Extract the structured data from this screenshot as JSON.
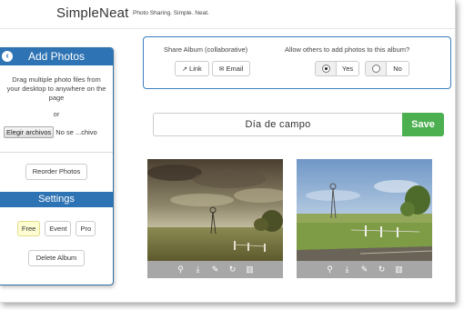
{
  "header": {
    "brand": "SimpleNeat",
    "tagline": "Photo Sharing. Simple. Neat."
  },
  "sidebar": {
    "title": "Add Photos",
    "drag_text": "Drag multiple photo files from your desktop to anywhere on the page",
    "or_text": "or",
    "file_button": "Elegir archivos",
    "file_status": "No se ...chivo",
    "reorder_label": "Reorder Photos",
    "settings_title": "Settings",
    "modes": [
      {
        "label": "Free",
        "active": true
      },
      {
        "label": "Event",
        "active": false
      },
      {
        "label": "Pro",
        "active": false
      }
    ],
    "delete_label": "Delete Album"
  },
  "share": {
    "label": "Share Album (collaborative)",
    "link_label": "Link",
    "email_label": "Email",
    "allow_label": "Allow others to add photos to this album?",
    "yes_label": "Yes",
    "no_label": "No",
    "selected": "yes"
  },
  "album": {
    "name": "Día de campo",
    "save_label": "Save"
  },
  "photos": [
    {
      "name": "photo-windmill-cloudy"
    },
    {
      "name": "photo-windmill-road"
    }
  ],
  "photo_tools": [
    "zoom-icon",
    "download-icon",
    "edit-icon",
    "rotate-icon",
    "trash-icon"
  ],
  "colors": {
    "accent": "#2e73b3",
    "save": "#4caf50",
    "toolbar": "#a7a7a7",
    "active_mode": "#fdfcd2"
  }
}
